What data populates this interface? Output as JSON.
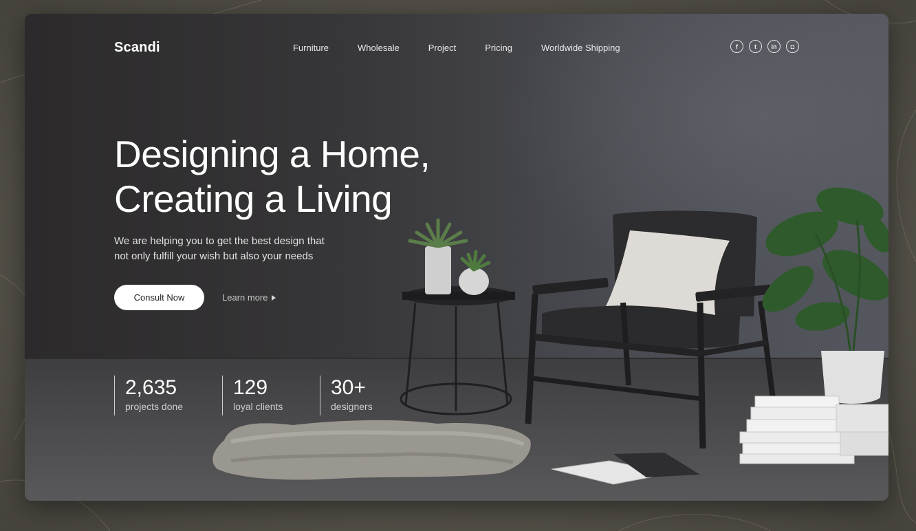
{
  "brand": {
    "logo": "Scandi"
  },
  "nav": {
    "items": [
      {
        "label": "Furniture"
      },
      {
        "label": "Wholesale"
      },
      {
        "label": "Project"
      },
      {
        "label": "Pricing"
      },
      {
        "label": "Worldwide Shipping"
      }
    ]
  },
  "socials": [
    {
      "icon": "facebook-icon",
      "glyph": "f"
    },
    {
      "icon": "twitter-icon",
      "glyph": "t"
    },
    {
      "icon": "linkedin-icon",
      "glyph": "in"
    },
    {
      "icon": "instagram-icon",
      "glyph": "◘"
    }
  ],
  "hero": {
    "title_line1": "Designing a Home,",
    "title_line2": "Creating a Living",
    "subtitle_line1": "We are helping you to get the best design that",
    "subtitle_line2": "not only fulfill your wish but also your needs",
    "primary_button": "Consult Now",
    "secondary_link": "Learn more"
  },
  "stats": [
    {
      "value": "2,635",
      "label": "projects done"
    },
    {
      "value": "129",
      "label": "loyal clients"
    },
    {
      "value": "30+",
      "label": "designers"
    }
  ],
  "colors": {
    "page_bg": "#57544b",
    "hero_bg": "#363537",
    "text": "#ffffff",
    "button_bg": "#ffffff",
    "button_text": "#222222"
  }
}
